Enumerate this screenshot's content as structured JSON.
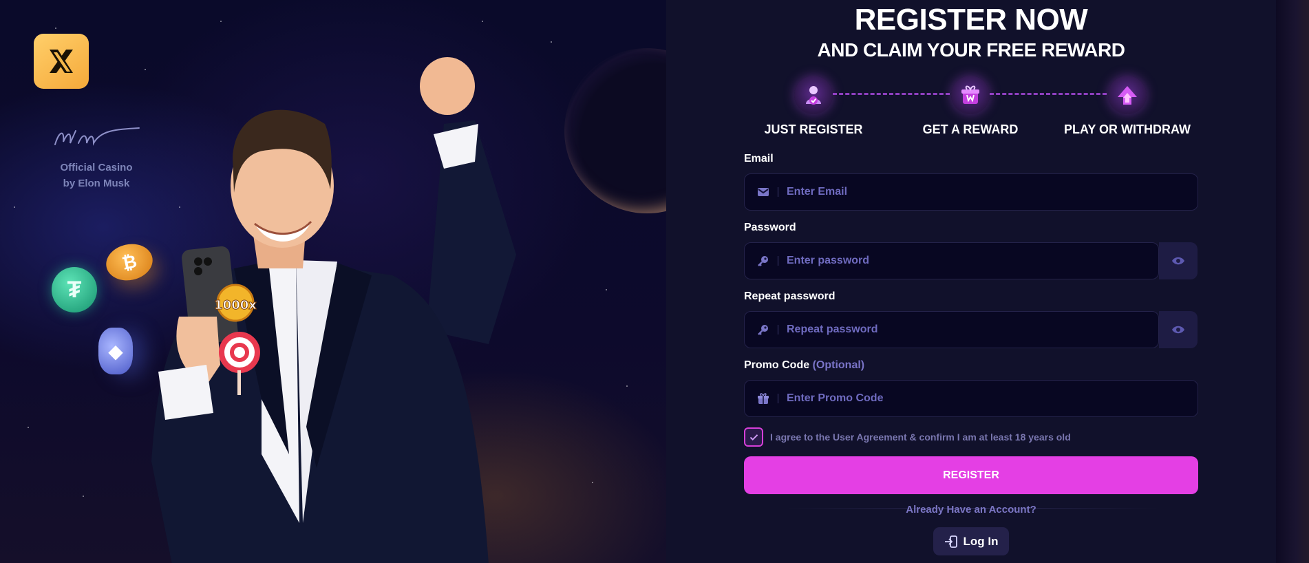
{
  "brand": {
    "logo_alt": "X",
    "tagline_line1": "Official Casino",
    "tagline_line2": "by Elon Musk"
  },
  "promo": {
    "badge_text": "1000x"
  },
  "header": {
    "title": "REGISTER NOW",
    "subtitle": "AND CLAIM YOUR FREE REWARD"
  },
  "steps": [
    {
      "label": "JUST REGISTER",
      "icon": "user-check-icon"
    },
    {
      "label": "GET A REWARD",
      "icon": "gift-icon"
    },
    {
      "label": "PLAY OR WITHDRAW",
      "icon": "arrow-up-icon"
    }
  ],
  "form": {
    "email": {
      "label": "Email",
      "placeholder": "Enter Email",
      "value": ""
    },
    "password": {
      "label": "Password",
      "placeholder": "Enter password",
      "value": ""
    },
    "repeat_password": {
      "label": "Repeat password",
      "placeholder": "Repeat password",
      "value": ""
    },
    "promo_code": {
      "label": "Promo Code",
      "optional": "(Optional)",
      "placeholder": "Enter Promo Code",
      "value": ""
    },
    "agreement": {
      "checked": true,
      "text": "I agree to the User Agreement & confirm I am at least 18 years old"
    },
    "register_label": "REGISTER",
    "already_text": "Already Have an Account?",
    "login_label": "Log In"
  },
  "colors": {
    "accent": "#e43fe4",
    "panel": "#11112b",
    "input_bg": "#080722",
    "logo": "#f5b84a"
  }
}
